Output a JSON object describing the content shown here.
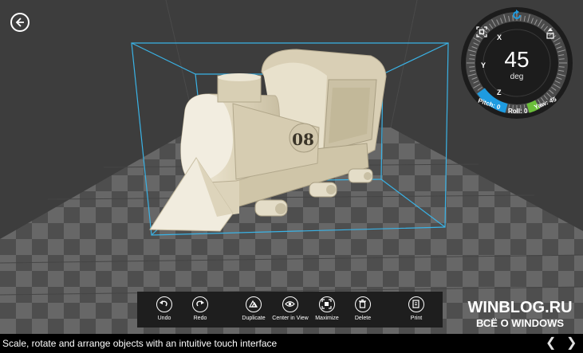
{
  "colors": {
    "background": "#3d3d3d",
    "floor_dark": "#4e4e4e",
    "floor_light": "#6a6a6a",
    "bounding_box": "#3ab3e6",
    "model": "#e3dbc5",
    "dial_accent_blue": "#1e9be0",
    "dial_accent_green": "#6bbf3a",
    "toolbar_bg": "#1e1e1e"
  },
  "viewport": {
    "model_name": "steam locomotive",
    "model_number": "08",
    "back_button_icon": "back-arrow-icon"
  },
  "dial": {
    "value": "45",
    "unit": "deg",
    "axes": {
      "x": "X",
      "y": "Y",
      "z": "Z"
    },
    "pitch": "Pitch: 0",
    "roll": "Roll: 0",
    "yaw": "Yaw: 45",
    "reset_icon": "rotate-reset-icon",
    "fit_icon": "fit-selection-icon",
    "move_icon": "move-vertical-icon"
  },
  "toolbar": {
    "undo": "Undo",
    "redo": "Redo",
    "duplicate": "Duplicate",
    "center_in_view": "Center in View",
    "maximize": "Maximize",
    "delete": "Delete",
    "print": "Print"
  },
  "caption": "Scale, rotate and arrange objects with an intuitive touch interface",
  "watermark": {
    "line1": "WINBLOG.RU",
    "line2": "ВСЁ О WINDOWS"
  },
  "nav": {
    "prev": "❮",
    "next": "❯"
  }
}
